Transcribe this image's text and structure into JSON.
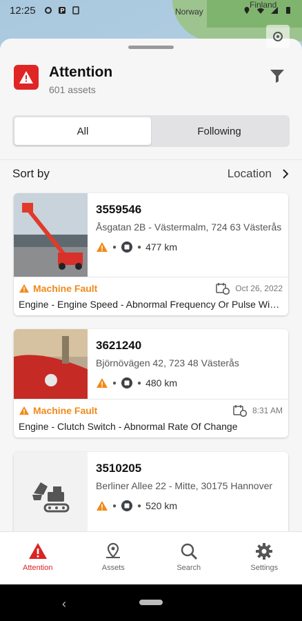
{
  "status_bar": {
    "time": "12:25"
  },
  "map": {
    "labels": [
      "Norway",
      "Finland"
    ]
  },
  "header": {
    "title": "Attention",
    "count": "601 assets"
  },
  "tabs": [
    {
      "label": "All",
      "active": true
    },
    {
      "label": "Following",
      "active": false
    }
  ],
  "sort": {
    "label": "Sort by",
    "value": "Location"
  },
  "assets": [
    {
      "id": "3559546",
      "address": "Åsgatan 2B - Västermalm, 724 63 Västerås",
      "distance": "477 km",
      "fault_type": "Machine Fault",
      "fault_date": "Oct 26, 2022",
      "fault_desc": "Engine - Engine Speed - Abnormal Frequency Or Pulse Width"
    },
    {
      "id": "3621240",
      "address": "Björnövägen 42, 723 48 Västerås",
      "distance": "480 km",
      "fault_type": "Machine Fault",
      "fault_date": "8:31 AM",
      "fault_desc": "Engine - Clutch Switch - Abnormal Rate Of Change"
    },
    {
      "id": "3510205",
      "address": "Berliner Allee 22 - Mitte, 30175 Hannover",
      "distance": "520 km"
    }
  ],
  "nav": [
    {
      "label": "Attention",
      "icon": "warning-icon",
      "active": true
    },
    {
      "label": "Assets",
      "icon": "map-pin-icon",
      "active": false
    },
    {
      "label": "Search",
      "icon": "search-icon",
      "active": false
    },
    {
      "label": "Settings",
      "icon": "gear-icon",
      "active": false
    }
  ],
  "colors": {
    "accent": "#d92525",
    "warning": "#f08a1b"
  }
}
